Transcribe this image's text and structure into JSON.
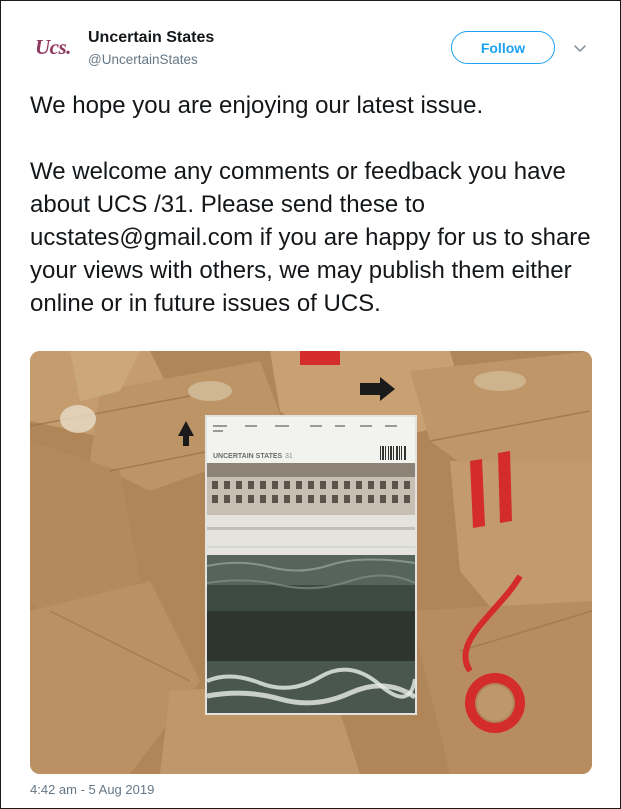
{
  "account": {
    "logo_text": "Ucs.",
    "display_name": "Uncertain States",
    "handle": "@UncertainStates"
  },
  "actions": {
    "follow_label": "Follow",
    "menu_icon": "chevron-down-icon"
  },
  "tweet": {
    "paragraphs": [
      "We hope you are enjoying our latest issue.",
      "We welcome any comments or feedback you have about UCS /31. Please send these to ucstates@gmail.com if you are happy for us to share your views with others, we may publish them either online or in future issues of UCS."
    ],
    "timestamp": "4:42 am - 5 Aug 2019"
  },
  "media": {
    "newspaper_masthead": "UNCERTAIN STATES",
    "newspaper_issue": "31"
  },
  "colors": {
    "brand": "#8e3a5e",
    "accent": "#1da1f2",
    "muted": "#657786",
    "cardboard": "#b48a5c",
    "tape_red": "#d42b2b"
  }
}
